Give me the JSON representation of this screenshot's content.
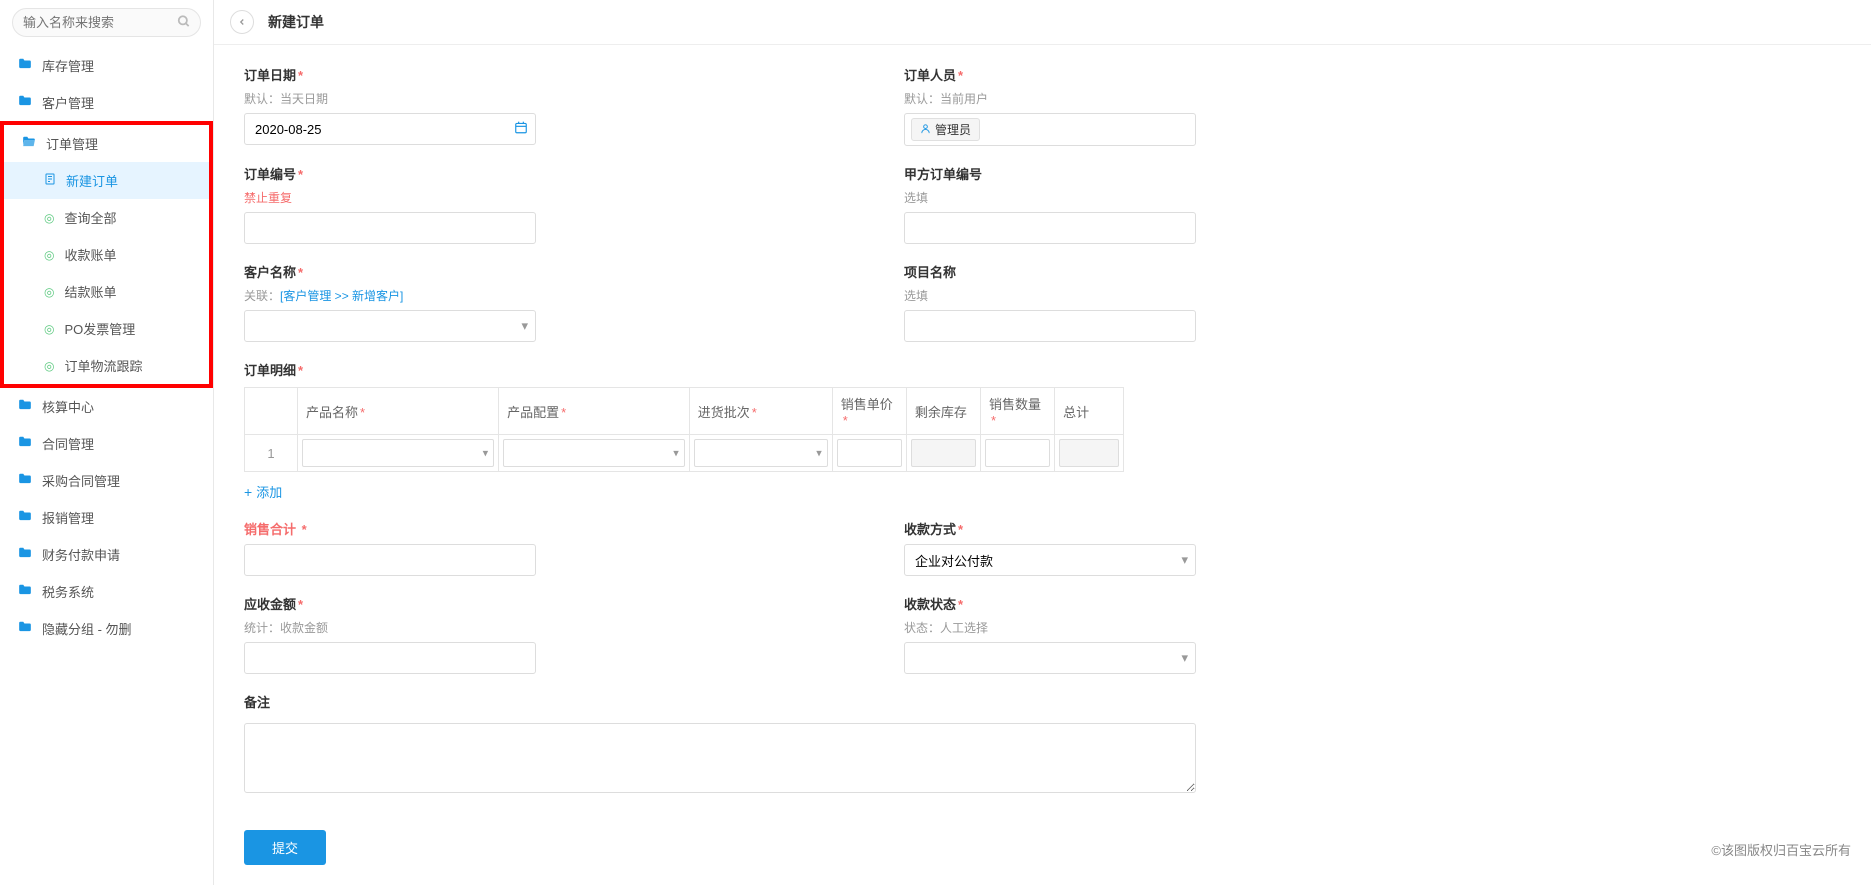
{
  "sidebar": {
    "search_placeholder": "输入名称来搜索",
    "items": [
      {
        "label": "库存管理"
      },
      {
        "label": "客户管理"
      },
      {
        "label": "订单管理",
        "open": true,
        "children": [
          {
            "label": "新建订单",
            "icon": "doc",
            "active": true
          },
          {
            "label": "查询全部",
            "icon": "circle"
          },
          {
            "label": "收款账单",
            "icon": "circle"
          },
          {
            "label": "结款账单",
            "icon": "circle"
          },
          {
            "label": "PO发票管理",
            "icon": "circle"
          },
          {
            "label": "订单物流跟踪",
            "icon": "circle"
          }
        ]
      },
      {
        "label": "核算中心"
      },
      {
        "label": "合同管理"
      },
      {
        "label": "采购合同管理"
      },
      {
        "label": "报销管理"
      },
      {
        "label": "财务付款申请"
      },
      {
        "label": "税务系统"
      },
      {
        "label": "隐藏分组 - 勿删"
      }
    ]
  },
  "header": {
    "title": "新建订单"
  },
  "form": {
    "order_date": {
      "label": "订单日期",
      "hint": "默认：当天日期",
      "value": "2020-08-25"
    },
    "order_staff": {
      "label": "订单人员",
      "hint": "默认：当前用户",
      "value": "管理员"
    },
    "order_no": {
      "label": "订单编号",
      "hint": "禁止重复"
    },
    "party_a_no": {
      "label": "甲方订单编号",
      "hint": "选填"
    },
    "customer": {
      "label": "客户名称",
      "hint_prefix": "关联：",
      "hint_link": "[客户管理 >> 新增客户]"
    },
    "project": {
      "label": "项目名称",
      "hint": "选填"
    },
    "detail": {
      "label": "订单明细",
      "columns": [
        "产品名称",
        "产品配置",
        "进货批次",
        "销售单价",
        "剩余库存",
        "销售数量",
        "总计"
      ],
      "required_cols": [
        true,
        true,
        true,
        true,
        false,
        true,
        false
      ],
      "row_num": "1",
      "add_label": "添加"
    },
    "sales_total": {
      "label": "销售合计"
    },
    "payment_method": {
      "label": "收款方式",
      "value": "企业对公付款"
    },
    "receivable": {
      "label": "应收金额",
      "hint": "统计：收款金额"
    },
    "payment_status": {
      "label": "收款状态",
      "hint": "状态：人工选择"
    },
    "remark": {
      "label": "备注"
    },
    "submit": "提交"
  },
  "copyright": "©该图版权归百宝云所有"
}
